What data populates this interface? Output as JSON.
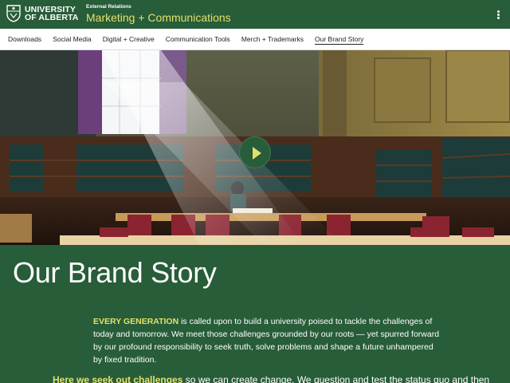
{
  "header": {
    "logo_line1": "UNIVERSITY",
    "logo_line2": "OF ALBERTA",
    "unit_sub": "External Relations",
    "unit_title": "Marketing + Communications"
  },
  "nav": {
    "items": [
      {
        "label": "Downloads"
      },
      {
        "label": "Social Media"
      },
      {
        "label": "Digital + Creative"
      },
      {
        "label": "Communication Tools"
      },
      {
        "label": "Merch + Trademarks"
      },
      {
        "label": "Our Brand Story"
      }
    ],
    "active_index": 5
  },
  "hero": {
    "play_icon": "play-icon"
  },
  "main": {
    "title": "Our Brand Story",
    "para1_lead": "EVERY GENERATION",
    "para1_text": " is called upon to build a university poised to tackle the challenges of today and tomorrow. We meet those challenges grounded by our roots — yet spurred forward by our profound responsibility to seek truth, solve problems and shape a future unhampered by fixed tradition.",
    "para2_lead": "Here we seek out challenges",
    "para2_text": " so we can create change. We question and test the status quo and then"
  },
  "colors": {
    "brand_green": "#275d38",
    "brand_gold": "#e3e06d",
    "nav_bg": "#ffffff"
  }
}
